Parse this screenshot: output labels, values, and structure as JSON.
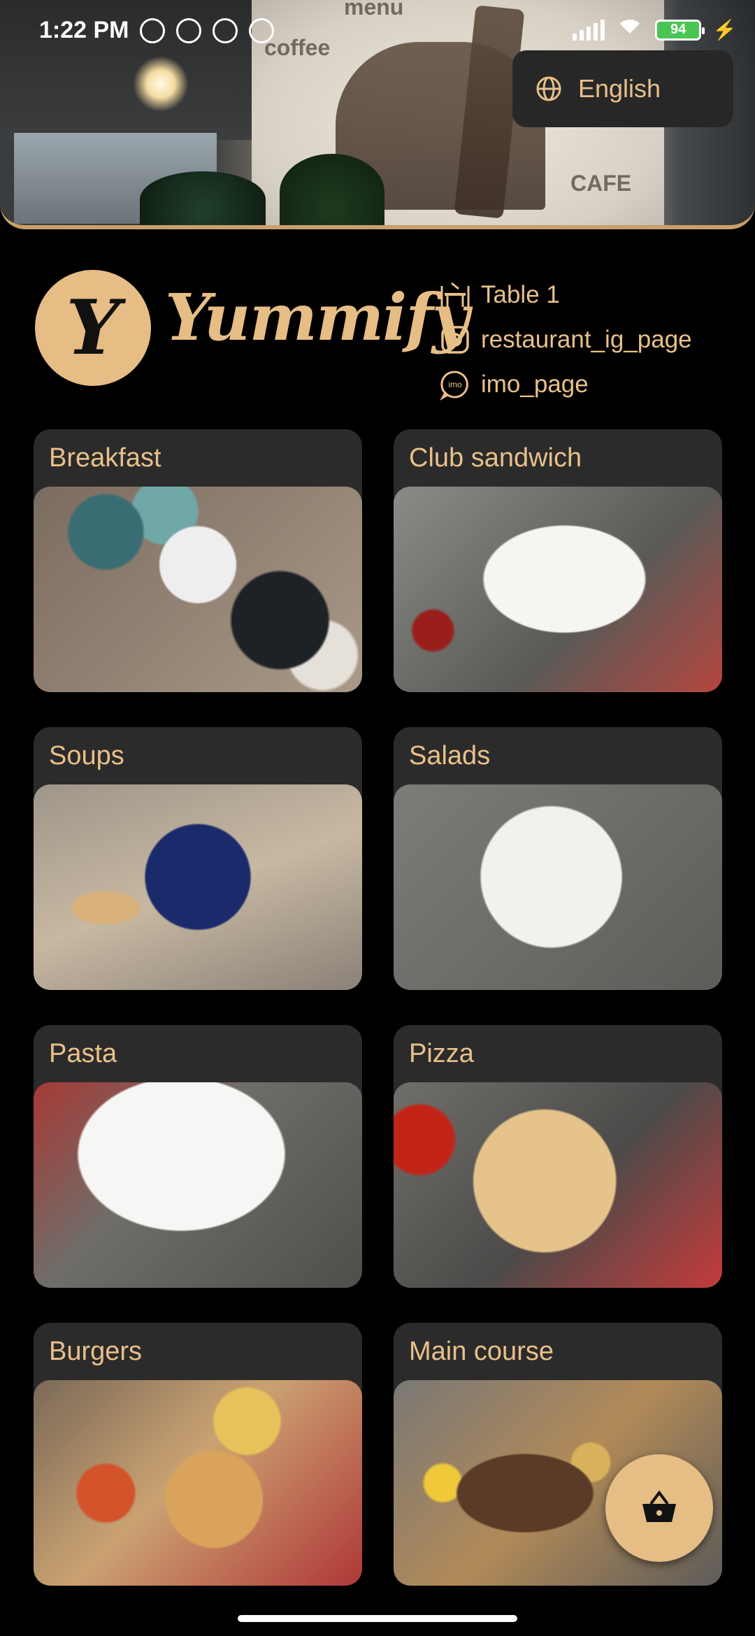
{
  "status_bar": {
    "time": "1:22 PM",
    "battery": "94"
  },
  "language": {
    "icon": "globe-icon",
    "label": "English"
  },
  "brand": {
    "logo_letter": "Y",
    "name": "Yummify"
  },
  "contact": {
    "table": "Table 1",
    "instagram": "restaurant_ig_page",
    "imo": "imo_page"
  },
  "hero_text": {
    "menu": "menu",
    "coffee": "coffee",
    "cafe": "CAFE"
  },
  "categories": [
    {
      "name": "Breakfast"
    },
    {
      "name": "Club sandwich"
    },
    {
      "name": "Soups"
    },
    {
      "name": "Salads"
    },
    {
      "name": "Pasta"
    },
    {
      "name": "Pizza"
    },
    {
      "name": "Burgers"
    },
    {
      "name": "Main course"
    }
  ],
  "colors": {
    "accent": "#e6bd85",
    "card": "#2b2b2b",
    "background": "#000000"
  }
}
